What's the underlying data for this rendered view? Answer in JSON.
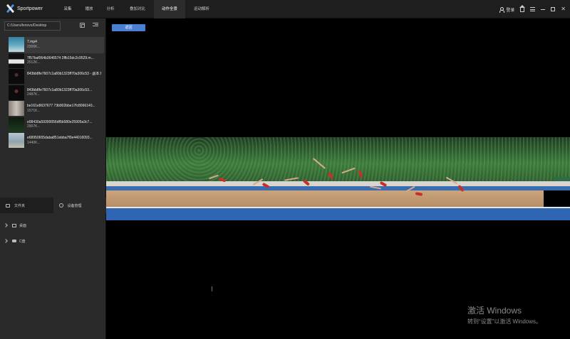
{
  "app": {
    "name": "Sportpower"
  },
  "nav": {
    "tabs": [
      {
        "label": "采集",
        "active": false
      },
      {
        "label": "播放",
        "active": false
      },
      {
        "label": "分析",
        "active": false
      },
      {
        "label": "叠加对比",
        "active": false
      },
      {
        "label": "动作全景",
        "active": true
      },
      {
        "label": "运动解析",
        "active": false
      }
    ]
  },
  "header_right": {
    "login_label": "登录"
  },
  "sidebar": {
    "path": "C:/Users/lenovo/Desktop",
    "files": [
      {
        "name": "7.mp4",
        "sub": "2306K...",
        "selected": true
      },
      {
        "name": "7f57baf064b3646574 2ffb15dc2c9529.m...",
        "sub": "2512K...",
        "selected": false
      },
      {
        "name": "843bb8fe7607c1a80b1323ff70a306c53 - 副本.MP4",
        "sub": "",
        "selected": false
      },
      {
        "name": "843bb8fe7607c1a80b1323ff70a306c53...",
        "sub": "2487K...",
        "selected": false
      },
      {
        "name": "be161e8637677 73b902bbe17fc8066140...",
        "sub": "1571K...",
        "selected": false
      },
      {
        "name": "e08430a59300056df5b580e25905a3c7...",
        "sub": "2907K...",
        "selected": false
      },
      {
        "name": "e68950655daba851ebba7f0e44016093...",
        "sub": "1440K...",
        "selected": false
      }
    ],
    "tabs": [
      {
        "label": "文件夹",
        "active": false
      },
      {
        "label": "设备管理",
        "active": true
      }
    ],
    "tree": [
      {
        "label": "桌面"
      },
      {
        "label": "C盘"
      }
    ]
  },
  "main": {
    "back_label": "返回"
  },
  "watermark": {
    "line1": "激活 Windows",
    "line2": "转到“设置”以激活 Windows。"
  },
  "colors": {
    "accent": "#4a7fd4",
    "topbar": "#1e1e1e",
    "sidebar": "#2a2a2a"
  }
}
